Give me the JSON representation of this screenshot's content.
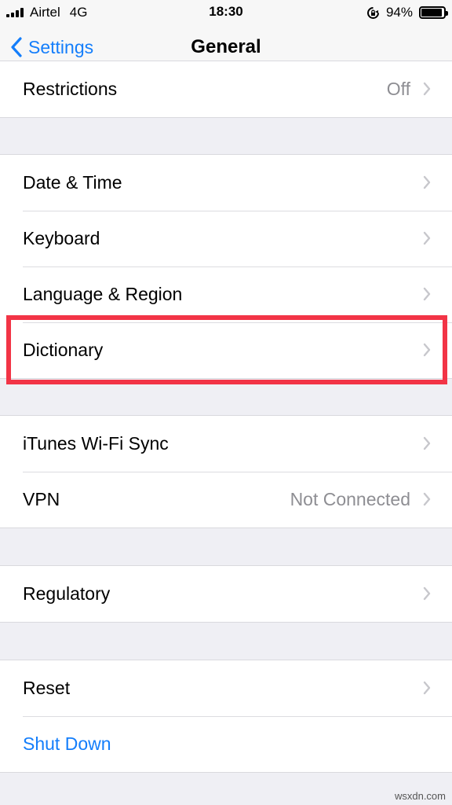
{
  "status_bar": {
    "carrier": "Airtel",
    "network": "4G",
    "time": "18:30",
    "battery_percent": "94%",
    "battery_level": 0.94,
    "icons": [
      "signal-bars-icon",
      "orientation-lock-icon",
      "battery-icon"
    ]
  },
  "nav": {
    "back_label": "Settings",
    "title": "General"
  },
  "groups": [
    {
      "rows": [
        {
          "label": "Restrictions",
          "value": "Off"
        }
      ]
    },
    {
      "rows": [
        {
          "label": "Date & Time"
        },
        {
          "label": "Keyboard"
        },
        {
          "label": "Language & Region"
        },
        {
          "label": "Dictionary"
        }
      ]
    },
    {
      "rows": [
        {
          "label": "iTunes Wi-Fi Sync"
        },
        {
          "label": "VPN",
          "value": "Not Connected"
        }
      ]
    },
    {
      "rows": [
        {
          "label": "Regulatory"
        }
      ]
    },
    {
      "rows": [
        {
          "label": "Reset"
        },
        {
          "label": "Shut Down"
        }
      ]
    }
  ],
  "colors": {
    "accent": "#147efb",
    "highlight": "#f23446",
    "background": "#efeff4"
  },
  "watermark": "wsxdn.com"
}
